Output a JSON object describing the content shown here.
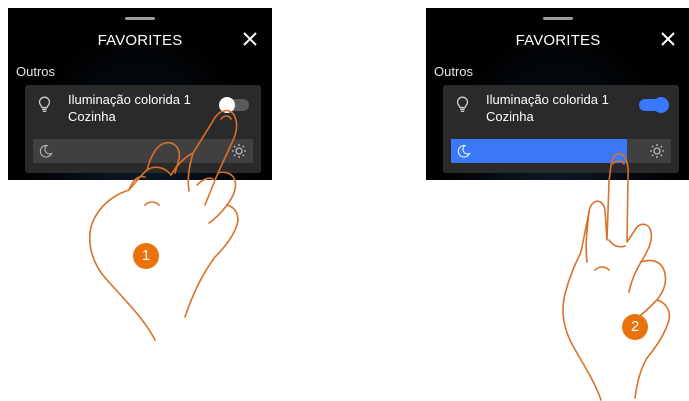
{
  "colors": {
    "accent_blue": "#3b78f5",
    "step_orange": "#e8720c",
    "hand_outline": "#d9712a",
    "card_bg": "#2a2a2a"
  },
  "panels": [
    {
      "header": {
        "title": "FAVORITES",
        "close_icon": "close-icon"
      },
      "section_label": "Outros",
      "device": {
        "name": "Iluminação colorida 1",
        "room": "Cozinha",
        "icon": "bulb-icon",
        "toggle_state": "off",
        "brightness_fraction": 0
      },
      "step_number": "1"
    },
    {
      "header": {
        "title": "FAVORITES",
        "close_icon": "close-icon"
      },
      "section_label": "Outros",
      "device": {
        "name": "Iluminação colorida 1",
        "room": "Cozinha",
        "icon": "bulb-icon",
        "toggle_state": "on",
        "brightness_fraction": 0.8
      },
      "step_number": "2"
    }
  ]
}
